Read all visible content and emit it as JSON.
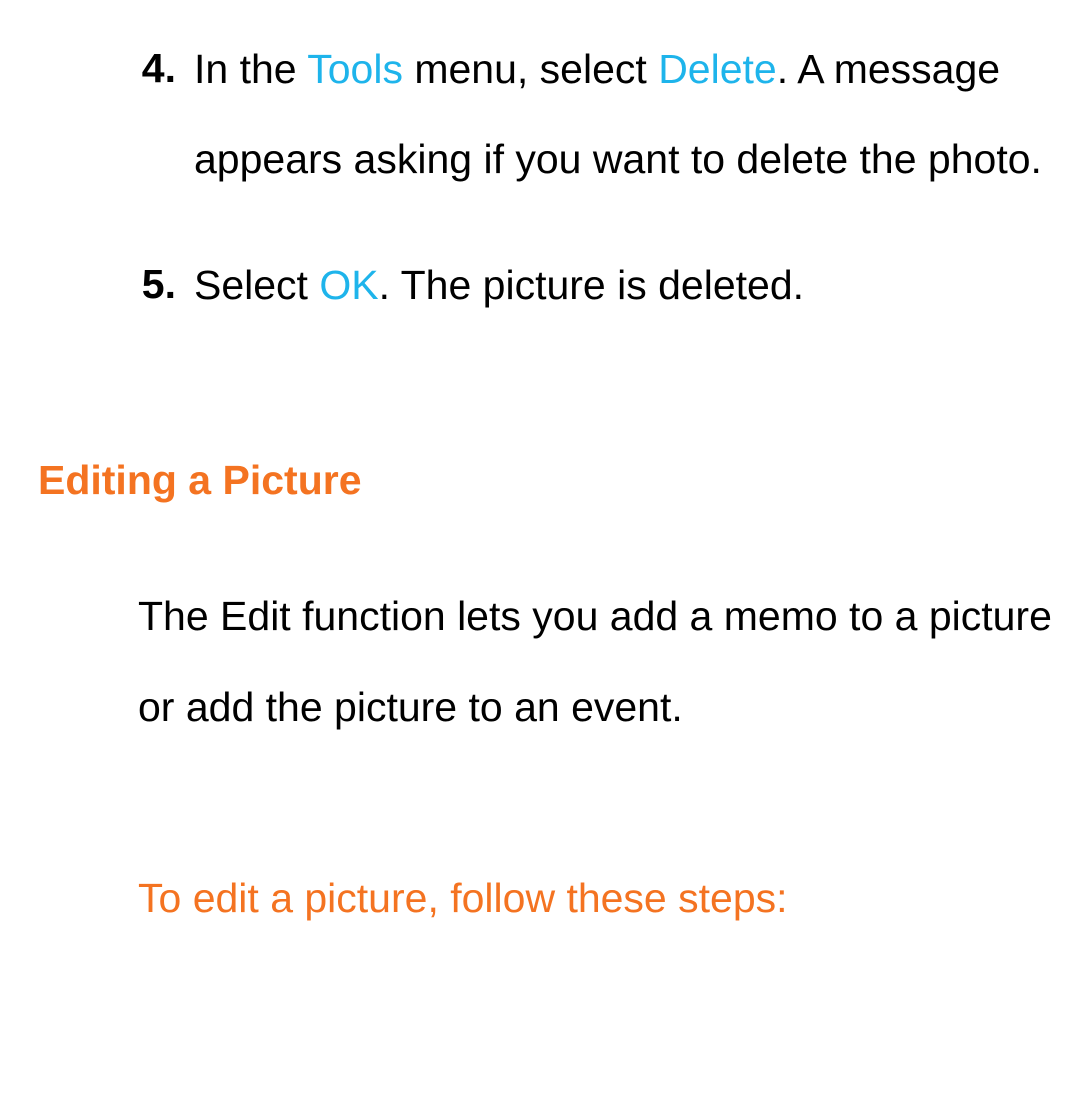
{
  "steps": [
    {
      "number": "4.",
      "segments": [
        {
          "text": "In the "
        },
        {
          "text": "Tools",
          "ui": true
        },
        {
          "text": " menu, select "
        },
        {
          "text": "Delete",
          "ui": true
        },
        {
          "text": ". A message appears asking if you want to delete the photo."
        }
      ]
    },
    {
      "number": "5.",
      "segments": [
        {
          "text": "Select "
        },
        {
          "text": "OK",
          "ui": true
        },
        {
          "text": ". The picture is deleted."
        }
      ]
    }
  ],
  "section": {
    "heading": "Editing a Picture",
    "paragraph": "The Edit function lets you add a memo to a picture or add the picture to an event.",
    "subheading": "To edit a picture, follow these steps:"
  }
}
